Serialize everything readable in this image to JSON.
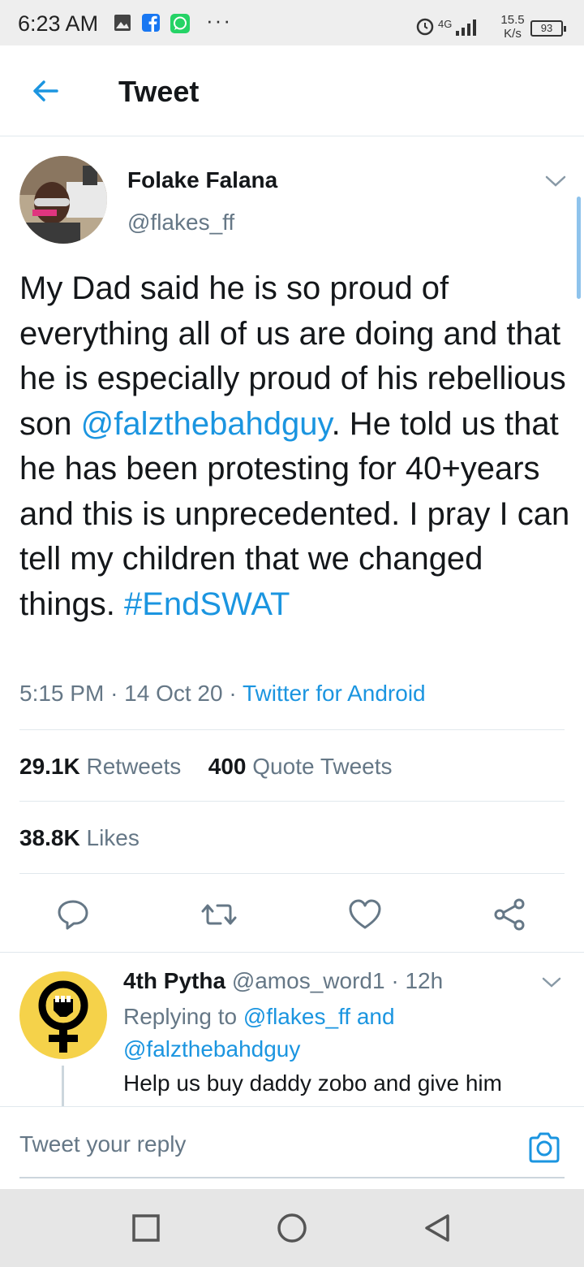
{
  "status_bar": {
    "time": "6:23 AM",
    "dots": "···",
    "network": "4G",
    "speed_value": "15.5",
    "speed_unit": "K/s",
    "battery": "93"
  },
  "header": {
    "title": "Tweet"
  },
  "tweet": {
    "author_name": "Folake Falana",
    "author_handle": "@flakes_ff",
    "text_part1": "My Dad said he is so proud of everything all of us are doing and that he is especially proud of his rebellious son ",
    "mention": "@falzthebahdguy",
    "text_part2": ". He told us that he has been protesting for 40+years and this is unprecedented. I pray I can tell my children that we changed things. ",
    "hashtag": "#EndSWAT",
    "time": "5:15 PM",
    "date": "14 Oct 20",
    "source": "Twitter for Android",
    "retweets_count": "29.1K",
    "retweets_label": "Retweets",
    "quotes_count": "400",
    "quotes_label": "Quote Tweets",
    "likes_count": "38.8K",
    "likes_label": "Likes"
  },
  "reply": {
    "author_name": "4th Pytha",
    "author_handle": "@amos_word1",
    "time": "12h",
    "replying_prefix": "Replying to",
    "replying_to_1": "@flakes_ff",
    "replying_and": "and",
    "replying_to_2": "@falzthebahdguy",
    "text": "Help us buy daddy zobo and give him"
  },
  "composer": {
    "placeholder": "Tweet your reply"
  },
  "colors": {
    "accent": "#1b95e0",
    "text_primary": "#14171a",
    "text_secondary": "#657786",
    "divider": "#e1e8ed",
    "reply_avatar_bg": "#f5d24a"
  }
}
